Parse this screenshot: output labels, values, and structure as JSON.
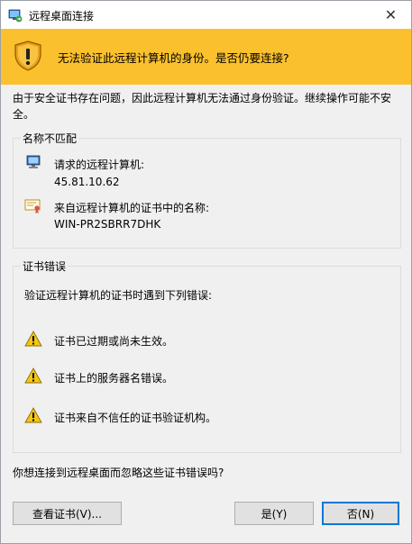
{
  "window": {
    "title": "远程桌面连接",
    "close_glyph": "✕"
  },
  "banner": {
    "message": "无法验证此远程计算机的身份。是否仍要连接?"
  },
  "intro": "由于安全证书存在问题，因此远程计算机无法通过身份验证。继续操作可能不安全。",
  "name_mismatch": {
    "legend": "名称不匹配",
    "requested_label": "请求的远程计算机:",
    "requested_value": "45.81.10.62",
    "cert_label": "来自远程计算机的证书中的名称:",
    "cert_value": "WIN-PR2SBRR7DHK"
  },
  "cert_errors": {
    "legend": "证书错误",
    "intro": "验证远程计算机的证书时遇到下列错误:",
    "errors": [
      "证书已过期或尚未生效。",
      "证书上的服务器名错误。",
      "证书来自不信任的证书验证机构。"
    ]
  },
  "question": "你想连接到远程桌面而忽略这些证书错误吗?",
  "buttons": {
    "view_cert": "查看证书(V)...",
    "yes": "是(Y)",
    "no": "否(N)"
  },
  "colors": {
    "banner": "#fbc02d",
    "default_button_border": "#0078d7"
  }
}
